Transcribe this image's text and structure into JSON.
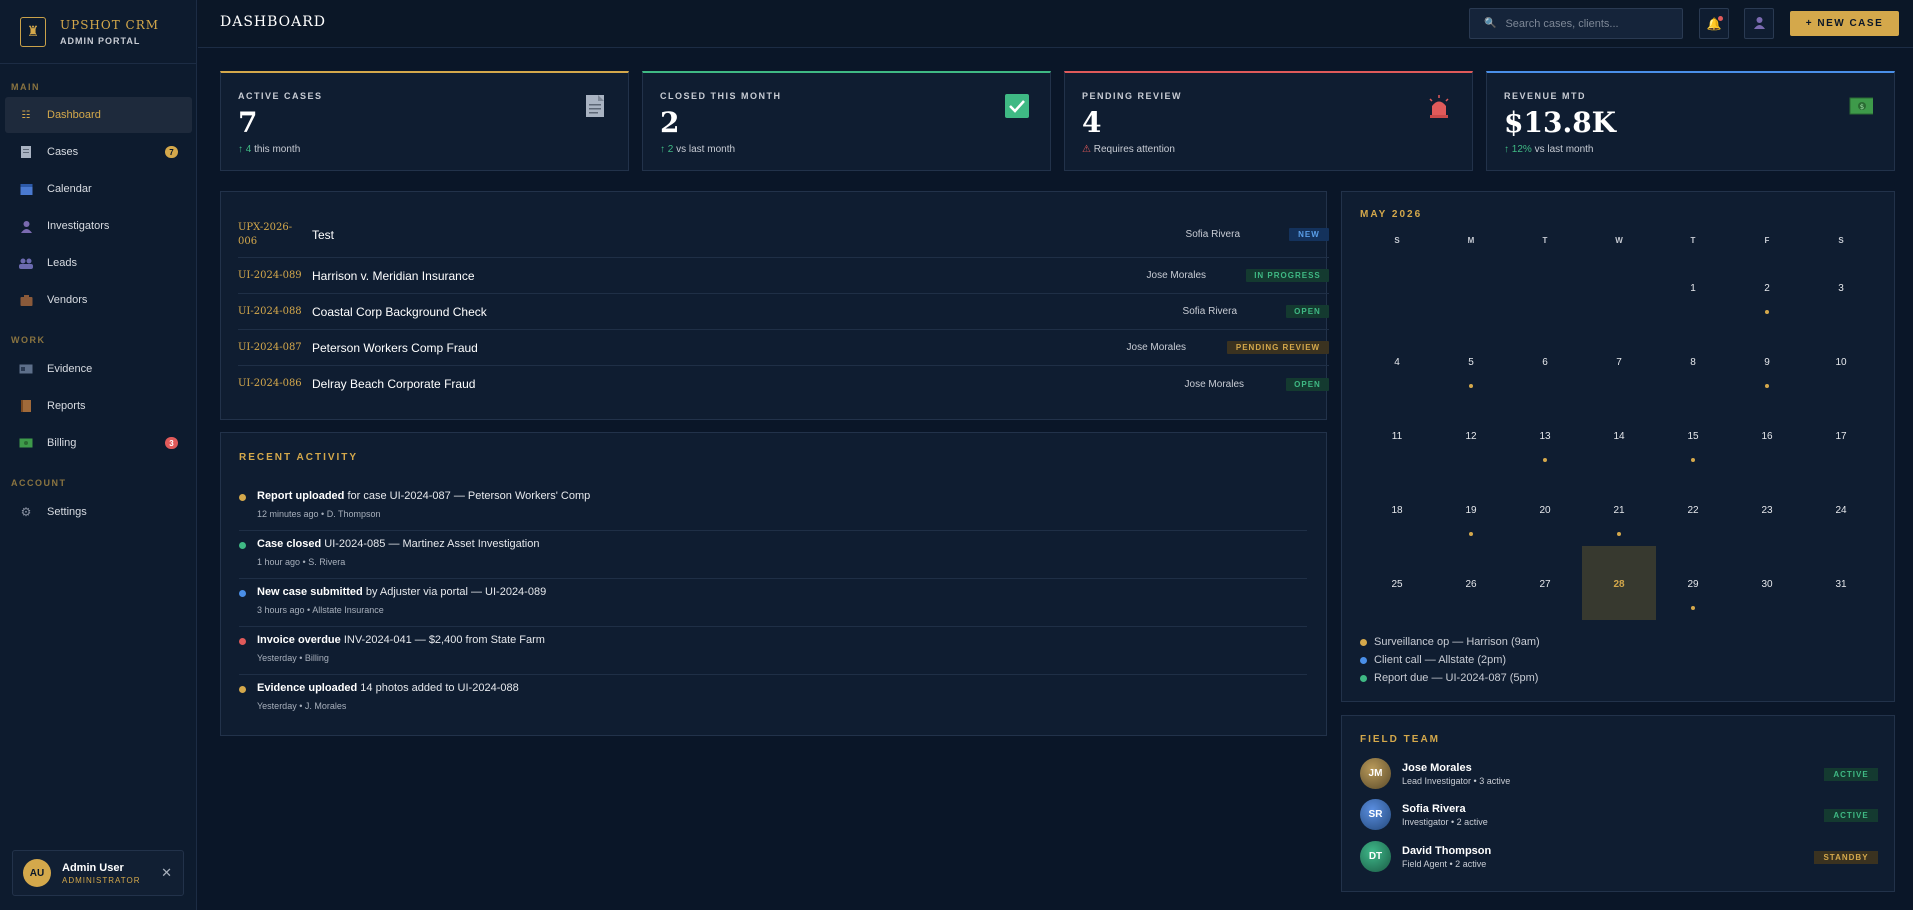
{
  "brand": {
    "name": "UPSHOT CRM",
    "subtitle": "ADMIN PORTAL"
  },
  "sidebar": {
    "sections": {
      "main": "MAIN",
      "work": "WORK",
      "account": "ACCOUNT"
    },
    "items": [
      {
        "label": "Dashboard",
        "icon": "dashboard-icon"
      },
      {
        "label": "Cases",
        "icon": "document-icon",
        "badge": "7"
      },
      {
        "label": "Calendar",
        "icon": "calendar-icon"
      },
      {
        "label": "Investigators",
        "icon": "person-icon"
      },
      {
        "label": "Leads",
        "icon": "people-icon"
      },
      {
        "label": "Vendors",
        "icon": "briefcase-icon"
      },
      {
        "label": "Evidence",
        "icon": "id-card-icon"
      },
      {
        "label": "Reports",
        "icon": "ledger-icon"
      },
      {
        "label": "Billing",
        "icon": "money-icon",
        "badge": "3"
      },
      {
        "label": "Settings",
        "icon": "gear-icon"
      }
    ],
    "user": {
      "initials": "AU",
      "name": "Admin User",
      "role": "ADMINISTRATOR"
    }
  },
  "topbar": {
    "title": "DASHBOARD",
    "search_placeholder": "Search cases, clients...",
    "new_case": "+ NEW CASE"
  },
  "stats": [
    {
      "label": "ACTIVE CASES",
      "value": "7",
      "delta": "4",
      "delta_text": "this month",
      "icon": "document-icon",
      "accent": "#d4a84b"
    },
    {
      "label": "CLOSED THIS MONTH",
      "value": "2",
      "delta": "2",
      "delta_text": "vs last month",
      "icon": "check-icon",
      "accent": "#3fb984"
    },
    {
      "label": "PENDING REVIEW",
      "value": "4",
      "delta_text": "Requires attention",
      "icon": "alarm-icon",
      "accent": "#e05a5a"
    },
    {
      "label": "REVENUE MTD",
      "value": "$13.8K",
      "delta": "12%",
      "delta_text": "vs last month",
      "icon": "money-icon",
      "accent": "#4a8fe8"
    }
  ],
  "cases": [
    {
      "id": "UPX-2026-006",
      "title": "Test",
      "assignee": "Sofia Rivera",
      "status": "NEW"
    },
    {
      "id": "UI-2024-089",
      "title": "Harrison v. Meridian Insurance",
      "assignee": "Jose Morales",
      "status": "IN PROGRESS"
    },
    {
      "id": "UI-2024-088",
      "title": "Coastal Corp Background Check",
      "assignee": "Sofia Rivera",
      "status": "OPEN"
    },
    {
      "id": "UI-2024-087",
      "title": "Peterson Workers Comp Fraud",
      "assignee": "Jose Morales",
      "status": "PENDING REVIEW"
    },
    {
      "id": "UI-2024-086",
      "title": "Delray Beach Corporate Fraud",
      "assignee": "Jose Morales",
      "status": "OPEN"
    }
  ],
  "activity": {
    "title": "RECENT ACTIVITY",
    "items": [
      {
        "bold": "Report uploaded",
        "text": " for case UI-2024-087 — Peterson Workers' Comp",
        "meta": "12 minutes ago • D. Thompson",
        "color": "#d4a84b"
      },
      {
        "bold": "Case closed",
        "text": " UI-2024-085 — Martinez Asset Investigation",
        "meta": "1 hour ago • S. Rivera",
        "color": "#3fb984"
      },
      {
        "bold": "New case submitted",
        "text": " by Adjuster via portal — UI-2024-089",
        "meta": "3 hours ago • Allstate Insurance",
        "color": "#4a8fe8"
      },
      {
        "bold": "Invoice overdue",
        "text": " INV-2024-041 — $2,400 from State Farm",
        "meta": "Yesterday • Billing",
        "color": "#e05a5a"
      },
      {
        "bold": "Evidence uploaded",
        "text": " 14 photos added to UI-2024-088",
        "meta": "Yesterday • J. Morales",
        "color": "#d4a84b"
      }
    ]
  },
  "calendar": {
    "title": "MAY 2026",
    "weekdays": [
      "S",
      "M",
      "T",
      "W",
      "T",
      "F",
      "S"
    ],
    "days": [
      "",
      "",
      "",
      "",
      "1",
      "2",
      "3",
      "4",
      "5",
      "6",
      "7",
      "8",
      "9",
      "10",
      "11",
      "12",
      "13",
      "14",
      "15",
      "16",
      "17",
      "18",
      "19",
      "20",
      "21",
      "22",
      "23",
      "24",
      "25",
      "26",
      "27",
      "28",
      "29",
      "30",
      "31"
    ],
    "event_days": [
      "2",
      "5",
      "9",
      "13",
      "15",
      "19",
      "21",
      "29"
    ],
    "today": "28",
    "legend": [
      {
        "text": "Surveillance op — Harrison (9am)",
        "color": "#d4a84b"
      },
      {
        "text": "Client call — Allstate (2pm)",
        "color": "#4a8fe8"
      },
      {
        "text": "Report due — UI-2024-087 (5pm)",
        "color": "#3fb984"
      }
    ]
  },
  "team": {
    "title": "FIELD TEAM",
    "members": [
      {
        "initials": "JM",
        "name": "Jose Morales",
        "role": "Lead Investigator • 3 active",
        "status": "ACTIVE"
      },
      {
        "initials": "SR",
        "name": "Sofia Rivera",
        "role": "Investigator • 2 active",
        "status": "ACTIVE"
      },
      {
        "initials": "DT",
        "name": "David Thompson",
        "role": "Field Agent • 2 active",
        "status": "STANDBY"
      }
    ]
  }
}
